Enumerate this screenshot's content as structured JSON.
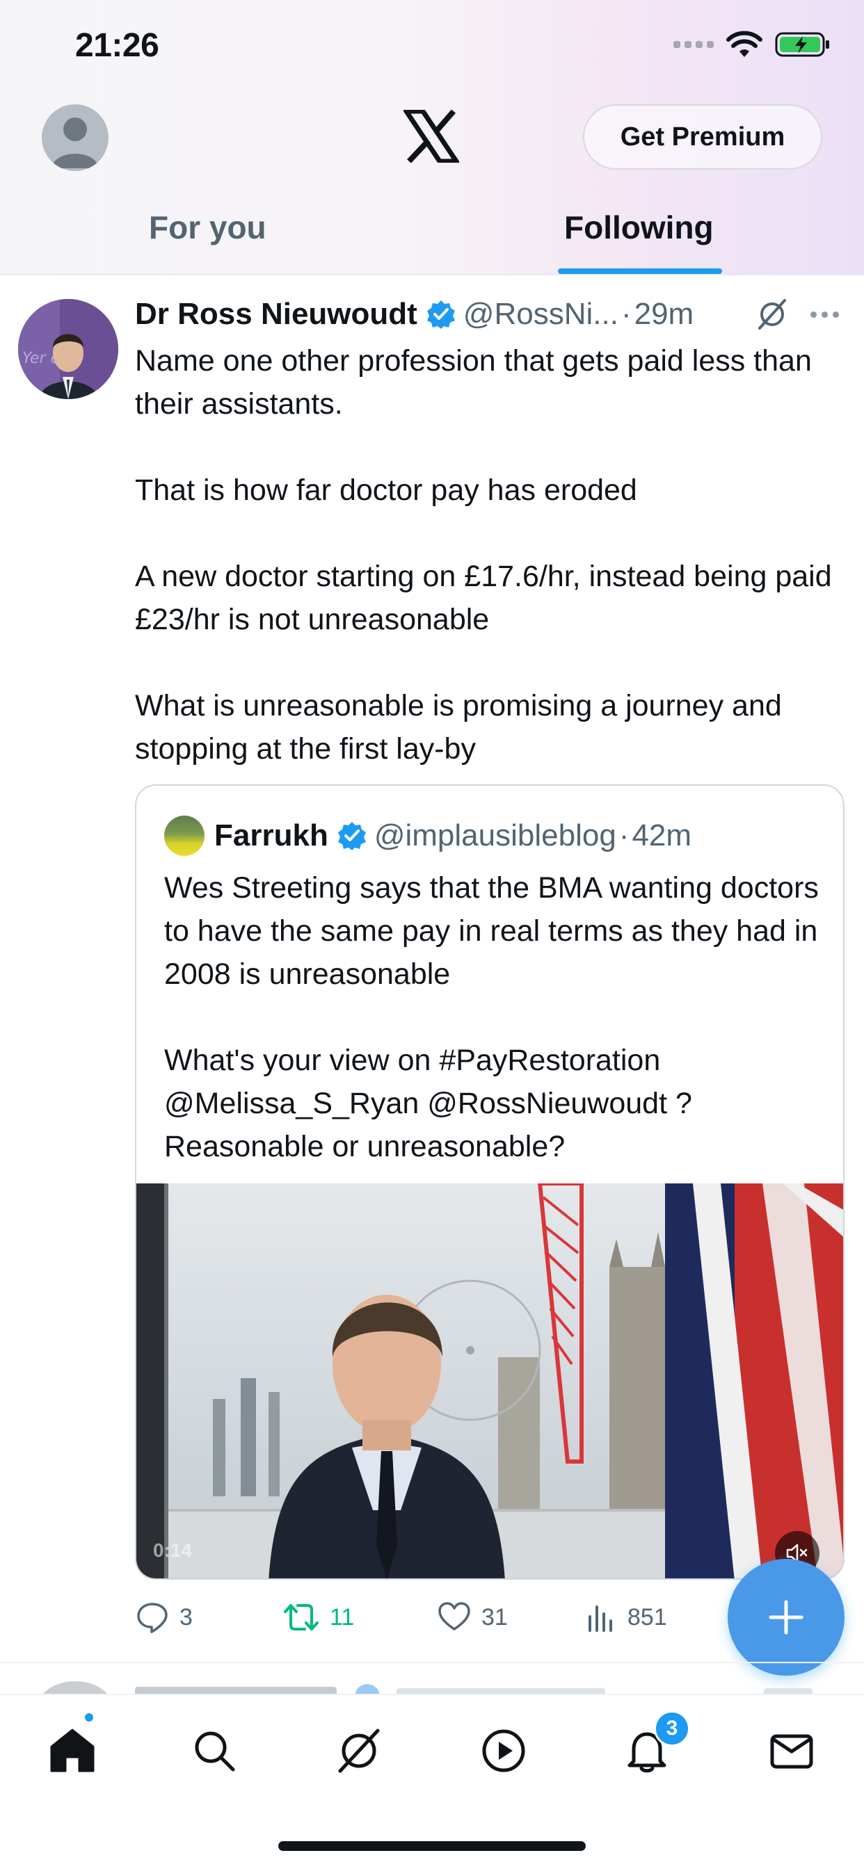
{
  "status_bar": {
    "time": "21:26"
  },
  "header": {
    "premium_label": "Get Premium",
    "tabs": [
      {
        "label": "For you",
        "active": false
      },
      {
        "label": "Following",
        "active": true
      }
    ],
    "accent_color": "#1d9bf0"
  },
  "tweet": {
    "author_name": "Dr Ross Nieuwoudt",
    "author_handle": "@RossNi...",
    "separator": "·",
    "time": "29m",
    "paragraphs": [
      "Name one other profession that gets paid less than their assistants.",
      "That is how far doctor pay has eroded",
      "A new doctor starting on £17.6/hr, instead being paid £23/hr is not unreasonable",
      "What is unreasonable is promising a journey and stopping at the first lay-by"
    ],
    "quote": {
      "author_name": "Farrukh",
      "author_handle": "@implausibleblog",
      "separator": "·",
      "time": "42m",
      "paragraphs": [
        "Wes Streeting says that the BMA wanting doctors to have the same pay in real terms as they had in 2008 is unreasonable",
        "What's your view on #PayRestoration @Melissa_S_Ryan  @RossNieuwoudt ? Reasonable or unreasonable?"
      ],
      "video": {
        "timestamp": "0:14"
      }
    },
    "actions": {
      "replies": "3",
      "reposts": "11",
      "likes": "31",
      "views": "851"
    }
  },
  "bottom_nav": {
    "items": [
      "home-icon",
      "search-icon",
      "grok-icon",
      "video-icon",
      "notifications-icon",
      "messages-icon"
    ],
    "notification_count": "3"
  },
  "colors": {
    "text_primary": "#0f1419",
    "text_secondary": "#536471",
    "repost_green": "#00ba7c",
    "fab_blue": "#4a99e9"
  }
}
